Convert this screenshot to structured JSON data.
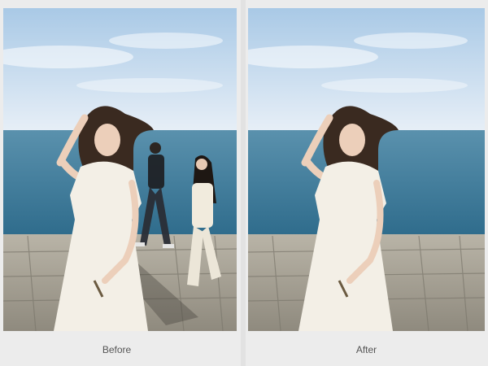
{
  "panels": [
    {
      "caption": "Before"
    },
    {
      "caption": "After"
    }
  ],
  "scene": {
    "sky_top": "#bcd6ee",
    "sky_bottom": "#e4eef7",
    "sea": "#4f8aa6",
    "sea_dark": "#3d7390",
    "stone": "#a9a497",
    "dress": "#f3efe6",
    "hair": "#3a2a20"
  }
}
